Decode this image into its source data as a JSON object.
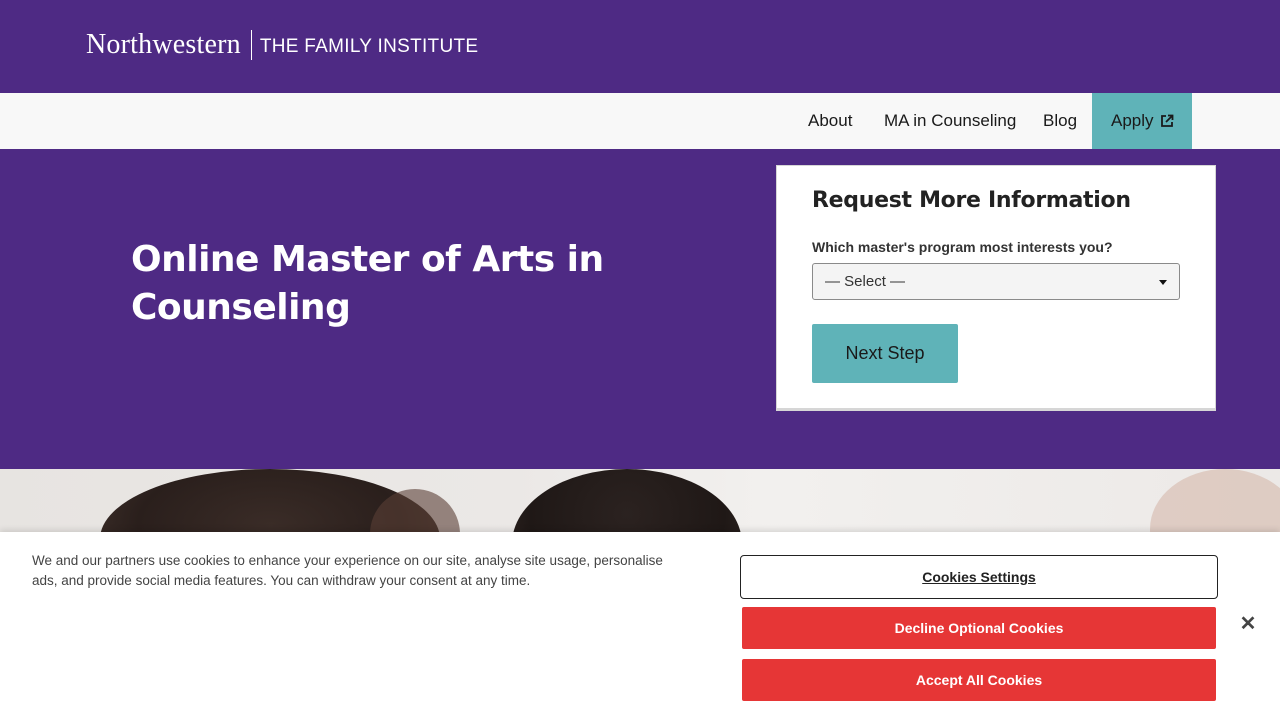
{
  "header": {
    "logo_primary": "Northwestern",
    "logo_secondary": "THE FAMILY INSTITUTE"
  },
  "nav": {
    "items": [
      {
        "label": "About"
      },
      {
        "label": "MA in Counseling"
      },
      {
        "label": "Blog"
      },
      {
        "label": "Apply",
        "icon": "external-link-icon"
      }
    ]
  },
  "hero": {
    "title": "Online Master of Arts in Counseling"
  },
  "form": {
    "title": "Request More Information",
    "question_label": "Which master's program most interests you?",
    "select_value": "— Select —",
    "next_label": "Next Step"
  },
  "cookie_banner": {
    "text": "We and our partners use cookies to enhance your experience on our site, analyse site usage, personalise ads, and provide social media features. You can withdraw your consent at any time.",
    "settings_label": "Cookies Settings",
    "decline_label": "Decline Optional Cookies",
    "accept_label": "Accept All Cookies",
    "close_icon": "close-icon"
  },
  "colors": {
    "brand_purple": "#4e2a84",
    "accent_teal": "#5fb3b8",
    "cookie_red": "#e63636"
  }
}
